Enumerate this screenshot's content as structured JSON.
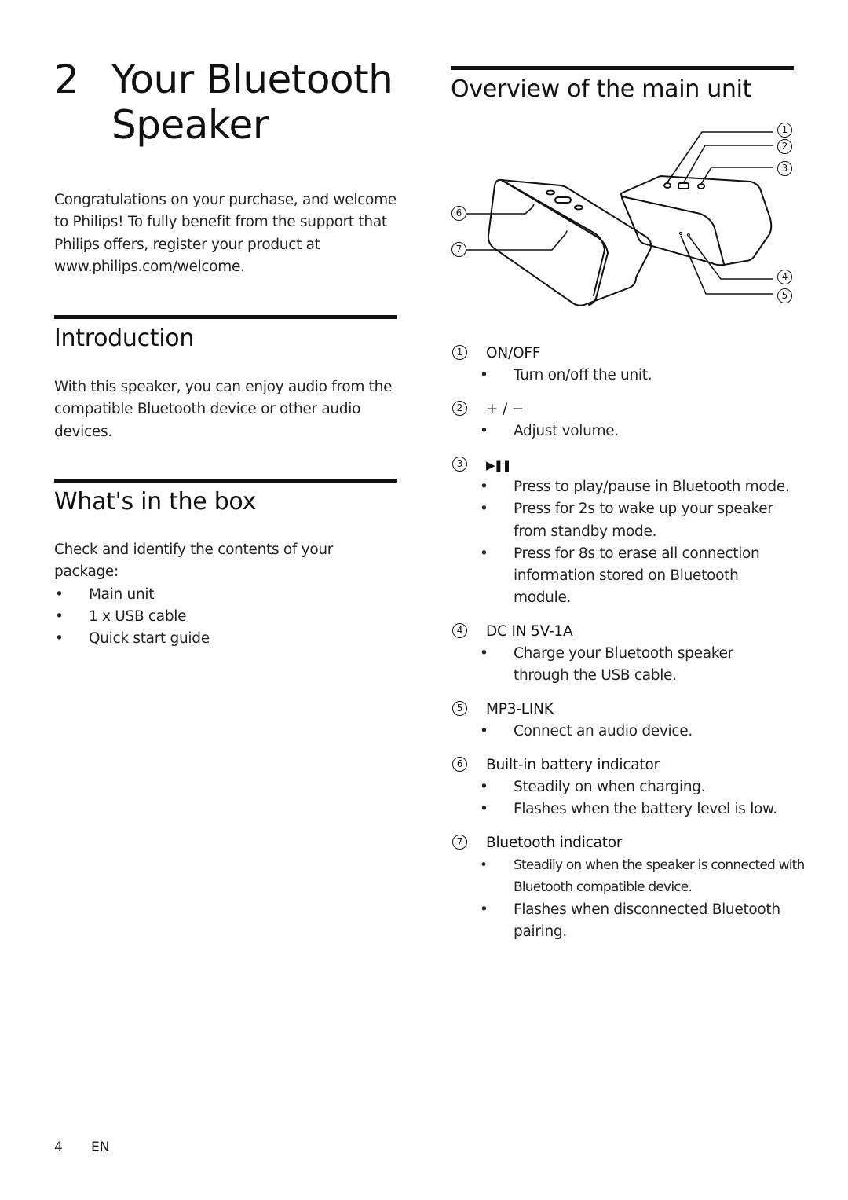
{
  "chapter": {
    "number": "2",
    "title": "Your Bluetooth Speaker",
    "intro": "Congratulations on your purchase, and welcome to Philips! To fully benefit from the support that Philips offers, register your product at www.philips.com/welcome."
  },
  "introduction": {
    "heading": "Introduction",
    "text": "With this speaker, you can enjoy audio from the compatible Bluetooth device or other audio devices."
  },
  "whats_in_box": {
    "heading": "What's in the box",
    "text": "Check and identify the contents of your package:",
    "items": [
      "Main unit",
      "1 x USB cable",
      "Quick start guide"
    ]
  },
  "overview": {
    "heading": "Overview of the main unit",
    "callouts": [
      "1",
      "2",
      "3",
      "4",
      "5",
      "6",
      "7"
    ],
    "items": [
      {
        "num": "1",
        "label": "ON/OFF",
        "bullets": [
          "Turn on/off the unit."
        ]
      },
      {
        "num": "2",
        "label": "+ / −",
        "bullets": [
          "Adjust volume."
        ]
      },
      {
        "num": "3",
        "label": "▶❚❚",
        "bullets": [
          "Press to play/pause in Bluetooth mode.",
          "Press for 2s to wake up your speaker from standby mode.",
          "Press for 8s to erase all connection information stored on Bluetooth module."
        ]
      },
      {
        "num": "4",
        "label": "DC IN 5V-1A",
        "bullets": [
          "Charge your Bluetooth speaker through the USB cable."
        ]
      },
      {
        "num": "5",
        "label": "MP3-LINK",
        "bullets": [
          "Connect an audio device."
        ]
      },
      {
        "num": "6",
        "label": "Built-in battery indicator",
        "bullets": [
          "Steadily on when charging.",
          "Flashes when the battery level is low."
        ]
      },
      {
        "num": "7",
        "label": "Bluetooth indicator",
        "bullets": [
          "Steadily on when the speaker is connected with Bluetooth compatible device.",
          "Flashes when disconnected Bluetooth pairing."
        ]
      }
    ]
  },
  "footer": {
    "page_number": "4",
    "language": "EN"
  }
}
